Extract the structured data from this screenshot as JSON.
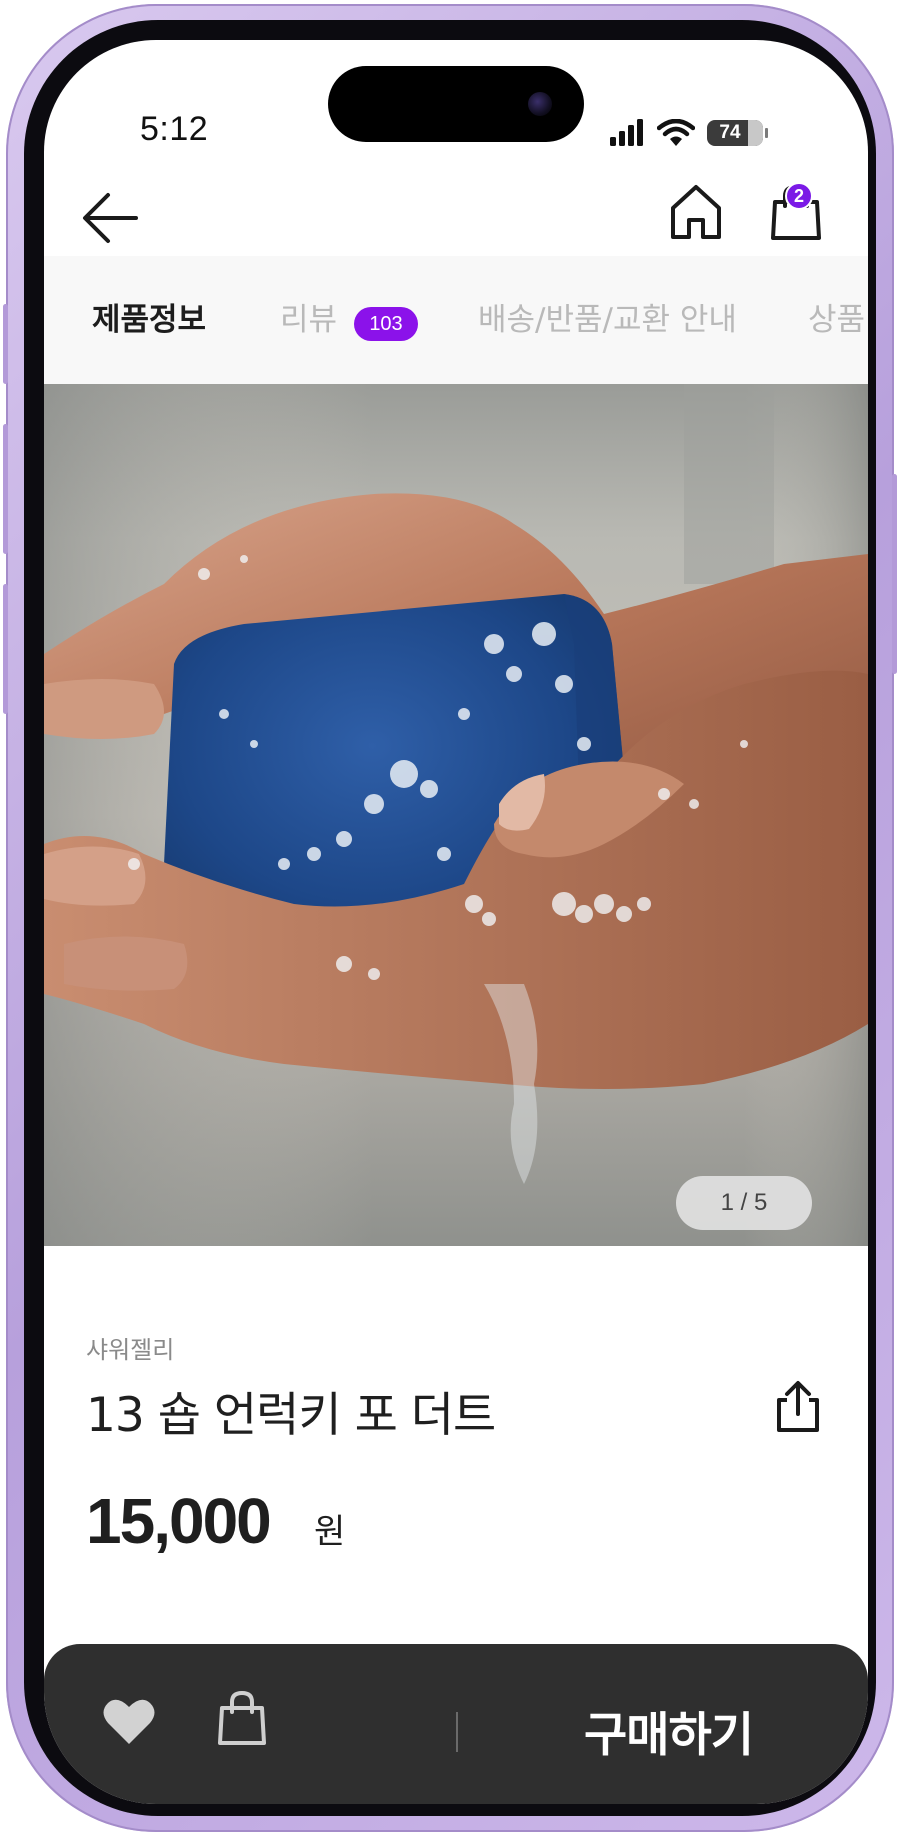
{
  "status_bar": {
    "time": "5:12",
    "battery": "74"
  },
  "header": {
    "back_icon": "arrow-left-icon",
    "home_icon": "home-icon",
    "cart_icon": "shopping-bag-icon",
    "cart_count": "2"
  },
  "tabs": {
    "items": [
      {
        "label": "제품정보",
        "active": true
      },
      {
        "label": "리뷰",
        "badge": "103"
      },
      {
        "label": "배송/반품/교환 안내"
      },
      {
        "label": "상품"
      }
    ]
  },
  "gallery": {
    "pager": "1 / 5"
  },
  "product": {
    "category": "샤워젤리",
    "title": "13 숍 언럭키 포 더트",
    "price": "15,000",
    "currency": "원"
  },
  "bottom_bar": {
    "buy_label": "구매하기"
  },
  "colors": {
    "accent": "#8b12ea",
    "bar": "#2f2f2f",
    "tab_bg": "#f8f8f8"
  }
}
